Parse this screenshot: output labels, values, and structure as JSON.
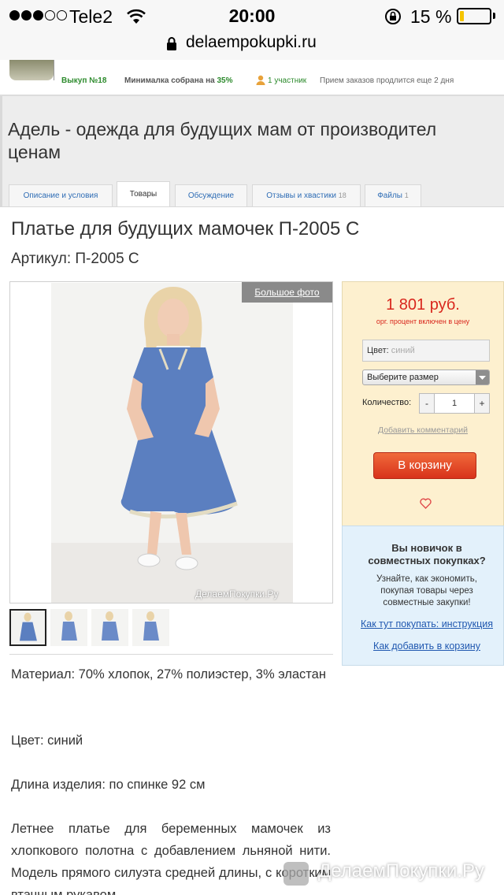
{
  "status_bar": {
    "carrier": "Tele2",
    "time": "20:00",
    "battery": "15 %",
    "battery_level": 0.15
  },
  "browser": {
    "url": "delaempokupki.ru"
  },
  "purchase_info": {
    "vykup": "Выкуп №18",
    "minimalka_prefix": "Минималка собрана на ",
    "minimalka_pct": "35%",
    "participants": "1 участник",
    "priem": "Прием заказов продлится еще 2 дня"
  },
  "header": {
    "title": "Адель - одежда для будущих мам от производител\nценам"
  },
  "tabs": [
    {
      "label": "Описание и условия",
      "count": ""
    },
    {
      "label": "Товары",
      "count": ""
    },
    {
      "label": "Обсуждение",
      "count": ""
    },
    {
      "label": "Отзывы и хвастики",
      "count": "18"
    },
    {
      "label": "Файлы",
      "count": "1"
    }
  ],
  "product": {
    "title": "Платье для будущих мамочек П-2005 С",
    "article": "Артикул: П-2005 С",
    "big_photo": "Большое фото",
    "photo_watermark": "ДелаемПокупки.Ру",
    "description": [
      "Материал: 70% хлопок, 27% полиэстер, 3% эластан",
      "Цвет: синий",
      "Длина изделия: по спинке 92 см",
      "Летнее платье для беременных мамочек из хлопкового полотна с добавлением льняной нити. Модель прямого силуэта средней длины, с коротким втачным рукавом."
    ]
  },
  "order": {
    "price": "1 801 руб.",
    "price_note": "орг. процент включен в цену",
    "color_label": "Цвет: ",
    "color_value": "синий",
    "size_select": "Выберите размер",
    "qty_label": "Количество:",
    "qty_minus": "-",
    "qty_value": "1",
    "qty_plus": "+",
    "add_comment": "Добавить комментарий",
    "cart_button": "В корзину"
  },
  "newbie": {
    "title": "Вы новичок в\nсовместных покупках?",
    "text": "Узнайте, как экономить,\nпокупая товары через\nсовместные закупки!",
    "link1": "Как тут покупать: инструкция",
    "link2": "Как добавить в корзину"
  },
  "site_mark": {
    "text": "ДелаемПокупки.Ру"
  },
  "colors": {
    "price_red": "#d9261c",
    "link_blue": "#2058b0",
    "order_box": "#fdf0cf",
    "newbie_box": "#e3f1fb",
    "dress_blue": "#5b7fc0"
  }
}
